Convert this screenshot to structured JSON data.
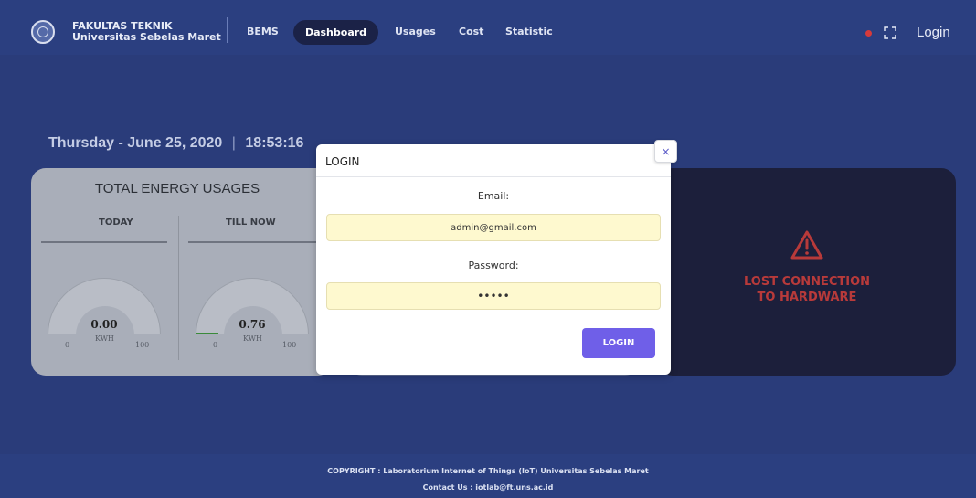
{
  "navbar": {
    "brand_line1": "FAKULTAS TEKNIK",
    "brand_line2": "Universitas Sebelas Maret",
    "items": [
      {
        "label": "BEMS"
      },
      {
        "label": "Dashboard"
      },
      {
        "label": "Usages"
      },
      {
        "label": "Cost"
      },
      {
        "label": "Statistic"
      }
    ],
    "login_label": "Login",
    "status_color": "#d63a3a"
  },
  "dashboard": {
    "day": "Thursday",
    "date": "June 25, 2020",
    "time": "18:53:16",
    "energy_card": {
      "title": "TOTAL ENERGY USAGES",
      "columns": [
        {
          "label": "TODAY",
          "value": "0.00",
          "unit": "KWH",
          "min": "0",
          "max": "100",
          "level": 0.0
        },
        {
          "label": "TILL NOW",
          "value": "0.76",
          "unit": "KWH",
          "min": "0",
          "max": "100",
          "level": 0.0076
        }
      ]
    },
    "alert": {
      "line1": "LOST CONNECTION",
      "line2": "TO HARDWARE",
      "color": "#b83a3a"
    }
  },
  "modal": {
    "title": "LOGIN",
    "close_symbol": "×",
    "email_label": "Email:",
    "email_value": "admin@gmail.com",
    "password_label": "Password:",
    "password_value": "•••••",
    "submit_label": "LOGIN",
    "accent": "#6f5fe8"
  },
  "footer": {
    "copyright": "COPYRIGHT : Laboratorium Internet of Things (IoT) Universitas Sebelas Maret",
    "contact": "Contact Us : iotlab@ft.uns.ac.id"
  }
}
